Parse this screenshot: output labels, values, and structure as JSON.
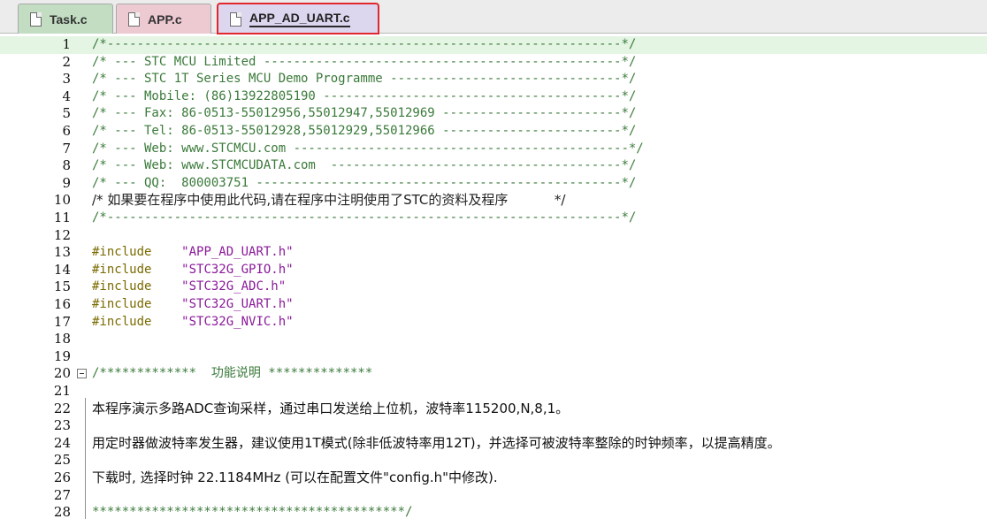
{
  "tabs": [
    {
      "label": "Task.c"
    },
    {
      "label": "APP.c"
    },
    {
      "label": "APP_AD_UART.c"
    }
  ],
  "lines": [
    {
      "n": "1",
      "text": "/*---------------------------------------------------------------------*/"
    },
    {
      "n": "2",
      "text": "/* --- STC MCU Limited ------------------------------------------------*/"
    },
    {
      "n": "3",
      "text": "/* --- STC 1T Series MCU Demo Programme -------------------------------*/"
    },
    {
      "n": "4",
      "text": "/* --- Mobile: (86)13922805190 ----------------------------------------*/"
    },
    {
      "n": "5",
      "text": "/* --- Fax: 86-0513-55012956,55012947,55012969 ------------------------*/"
    },
    {
      "n": "6",
      "text": "/* --- Tel: 86-0513-55012928,55012929,55012966 ------------------------*/"
    },
    {
      "n": "7",
      "text": "/* --- Web: www.STCMCU.com ---------------------------------------------*/"
    },
    {
      "n": "8",
      "text": "/* --- Web: www.STCMCUDATA.com  ---------------------------------------*/"
    },
    {
      "n": "9",
      "text": "/* --- QQ:  800003751 -------------------------------------------------*/"
    },
    {
      "n": "10",
      "text": "/* 如果要在程序中使用此代码,请在程序中注明使用了STC的资料及程序           */"
    },
    {
      "n": "11",
      "text": "/*---------------------------------------------------------------------*/"
    },
    {
      "n": "12",
      "text": ""
    },
    {
      "n": "13",
      "text": "#include",
      "arg": "\"APP_AD_UART.h\""
    },
    {
      "n": "14",
      "text": "#include",
      "arg": "\"STC32G_GPIO.h\""
    },
    {
      "n": "15",
      "text": "#include",
      "arg": "\"STC32G_ADC.h\""
    },
    {
      "n": "16",
      "text": "#include",
      "arg": "\"STC32G_UART.h\""
    },
    {
      "n": "17",
      "text": "#include",
      "arg": "\"STC32G_NVIC.h\""
    },
    {
      "n": "18",
      "text": ""
    },
    {
      "n": "19",
      "text": ""
    },
    {
      "n": "20",
      "text": "/*************  功能说明 **************"
    },
    {
      "n": "21",
      "text": ""
    },
    {
      "n": "22",
      "text": "本程序演示多路ADC查询采样，通过串口发送给上位机，波特率115200,N,8,1。"
    },
    {
      "n": "23",
      "text": ""
    },
    {
      "n": "24",
      "text": "用定时器做波特率发生器，建议使用1T模式(除非低波特率用12T)，并选择可被波特率整除的时钟频率，以提高精度。"
    },
    {
      "n": "25",
      "text": ""
    },
    {
      "n": "26",
      "text": "下载时, 选择时钟 22.1184MHz (可以在配置文件\"config.h\"中修改)."
    },
    {
      "n": "27",
      "text": ""
    },
    {
      "n": "28",
      "text": "******************************************/"
    }
  ]
}
